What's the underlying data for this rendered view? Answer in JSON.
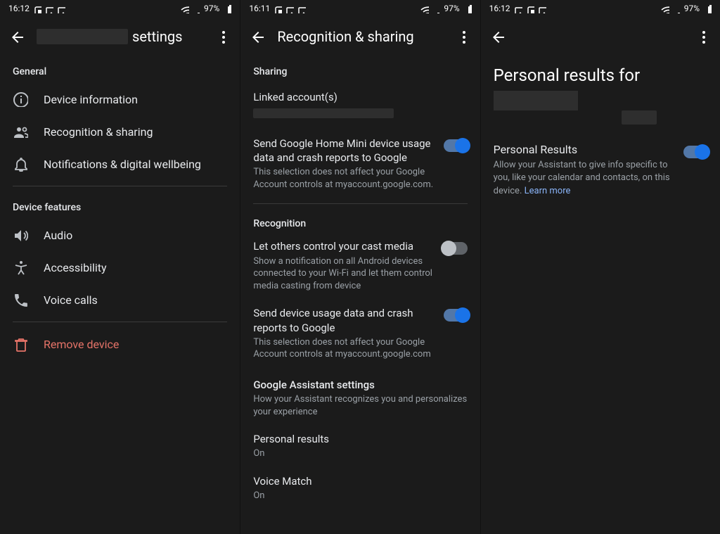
{
  "status": {
    "time_a": "16:12",
    "time_b": "16:11",
    "time_c": "16:12",
    "battery": "97%"
  },
  "panel1": {
    "title_suffix": "settings",
    "section_general": "General",
    "items_general": [
      "Device information",
      "Recognition & sharing",
      "Notifications & digital wellbeing"
    ],
    "section_features": "Device features",
    "items_features": [
      "Audio",
      "Accessibility",
      "Voice calls"
    ],
    "remove": "Remove device"
  },
  "panel2": {
    "title": "Recognition & sharing",
    "section_sharing": "Sharing",
    "linked_accounts": "Linked account(s)",
    "send_home": {
      "title": "Send Google Home Mini device usage data and crash reports to Google",
      "sub": "This selection does not affect your Google Account controls at myaccount.google.com."
    },
    "section_recognition": "Recognition",
    "cast": {
      "title": "Let others control your cast media",
      "sub": "Show a notification on all Android devices connected to your Wi-Fi and let them control media casting from device"
    },
    "send_device": {
      "title": "Send device usage data and crash reports to Google",
      "sub": "This selection does not affect your Google Account controls at myaccount.google.com"
    },
    "ga_settings": {
      "title": "Google Assistant settings",
      "sub": "How your Assistant recognizes you and personalizes your experience"
    },
    "personal_results": {
      "title": "Personal results",
      "sub": "On"
    },
    "voice_match": {
      "title": "Voice Match",
      "sub": "On"
    }
  },
  "panel3": {
    "bigtitle_prefix": "Personal results for",
    "pr": {
      "title": "Personal Results",
      "sub_a": "Allow your Assistant to give info specific to you, like your calendar and contacts, on this device. ",
      "learn_more": "Learn more"
    }
  }
}
